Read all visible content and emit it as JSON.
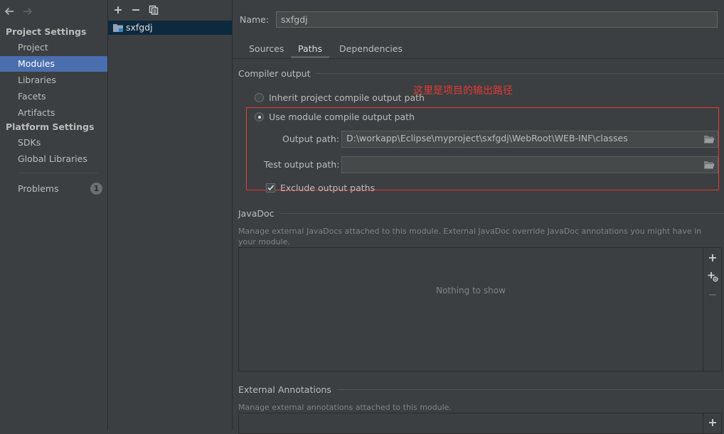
{
  "nav": {
    "back_icon": "arrow-left-icon",
    "forward_icon": "arrow-right-icon"
  },
  "sidebar": {
    "project_settings_header": "Project Settings",
    "project_items": [
      "Project",
      "Modules",
      "Libraries",
      "Facets",
      "Artifacts"
    ],
    "selected_item": "Modules",
    "platform_settings_header": "Platform Settings",
    "platform_items": [
      "SDKs",
      "Global Libraries"
    ],
    "problems_label": "Problems",
    "problems_count": "1"
  },
  "modules": {
    "toolbar": [
      "add-icon",
      "remove-icon",
      "copy-icon"
    ],
    "items": [
      {
        "name": "sxfgdj",
        "icon": "module-folder-icon"
      }
    ]
  },
  "module_settings": {
    "name_label": "Name:",
    "name_value": "sxfgdj",
    "tabs": [
      "Sources",
      "Paths",
      "Dependencies"
    ],
    "active_tab": "Paths",
    "compiler_output": {
      "title": "Compiler output",
      "inherit_label": "Inherit project compile output path",
      "use_module_label": "Use module compile output path",
      "selected": "use_module",
      "output_path_label": "Output path:",
      "output_path_value": "D:\\workapp\\Eclipse\\myproject\\sxfgdj\\WebRoot\\WEB-INF\\classes",
      "test_output_path_label": "Test output path:",
      "test_output_path_value": "",
      "exclude_label": "Exclude output paths",
      "exclude_checked": true,
      "annotation": "这里是项目的输出路径",
      "annotation_color": "#e53935"
    },
    "javadoc": {
      "title": "JavaDoc",
      "description": "Manage external JavaDocs attached to this module. External JavaDoc override JavaDoc annotations you might have in your module.",
      "empty_text": "Nothing to show",
      "tools": [
        "add-icon",
        "add-url-icon",
        "remove-icon"
      ]
    },
    "external_annotations": {
      "title": "External Annotations",
      "description": "Manage external annotations attached to this module.",
      "tools": [
        "add-icon"
      ]
    }
  },
  "colors": {
    "background": "#3c3f41",
    "selection": "#4b6eaf",
    "module_selection": "#0d293e",
    "highlight_box": "#e53935"
  }
}
